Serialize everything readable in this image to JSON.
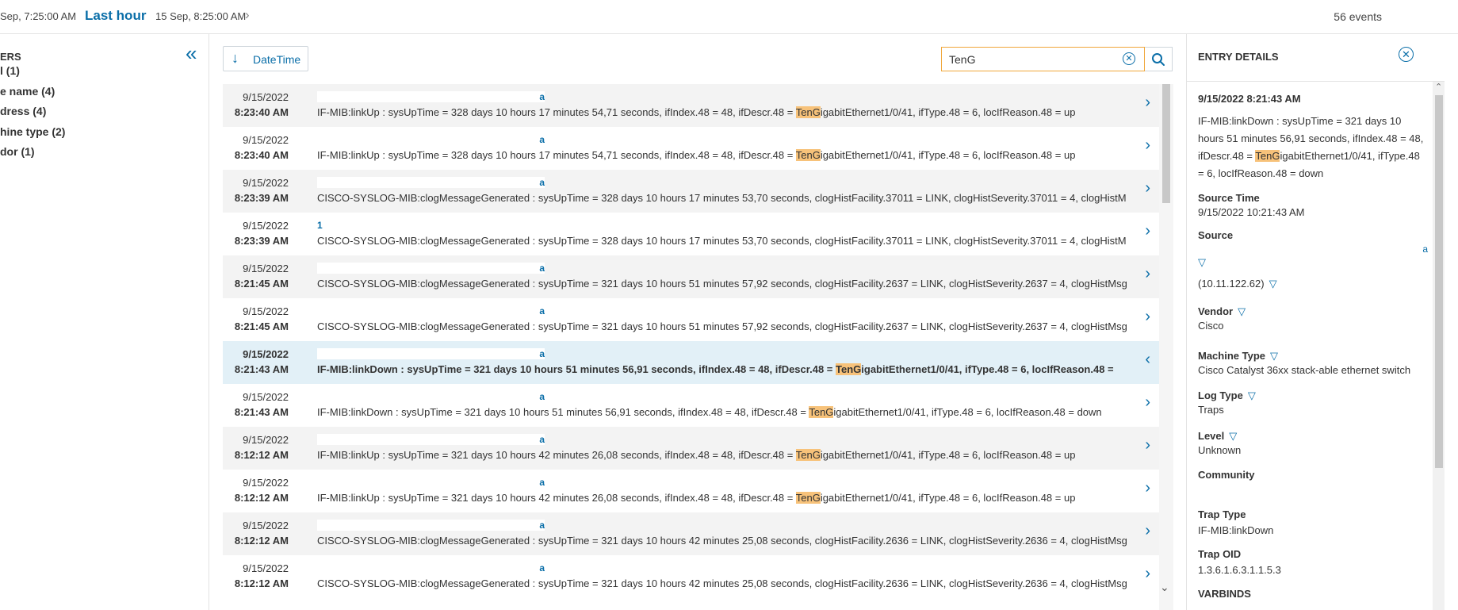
{
  "header": {
    "start": "Sep, 7:25:00 AM",
    "range_label": "Last hour",
    "end": "15 Sep, 8:25:00 AM",
    "event_count": "56 events"
  },
  "filters": {
    "title": "ERS",
    "items": [
      {
        "label": "l (1)"
      },
      {
        "label": "e name (4)"
      },
      {
        "label": "dress (4)"
      },
      {
        "label": "hine type (2)"
      },
      {
        "label": "dor (1)"
      }
    ]
  },
  "toolbar": {
    "sort_label": "DateTime",
    "search_value": "TenG",
    "search_placeholder": ""
  },
  "events": [
    {
      "date": "9/15/2022",
      "time": "8:23:40 AM",
      "source": "a",
      "pre": "IF-MIB:linkUp : sysUpTime = 328 days 10 hours 17 minutes 54,71 seconds, ifIndex.48 = 48, ifDescr.48 = ",
      "hl": "TenG",
      "post": "igabitEthernet1/0/41, ifType.48 = 6, locIfReason.48 = up"
    },
    {
      "date": "9/15/2022",
      "time": "8:23:40 AM",
      "source": "a",
      "pre": "IF-MIB:linkUp : sysUpTime = 328 days 10 hours 17 minutes 54,71 seconds, ifIndex.48 = 48, ifDescr.48 = ",
      "hl": "TenG",
      "post": "igabitEthernet1/0/41, ifType.48 = 6, locIfReason.48 = up"
    },
    {
      "date": "9/15/2022",
      "time": "8:23:39 AM",
      "source": "a",
      "pre": "CISCO-SYSLOG-MIB:clogMessageGenerated : sysUpTime = 328 days 10 hours 17 minutes 53,70 seconds, clogHistFacility.37011 = LINK, clogHistSeverity.37011 = 4, clogHistM",
      "hl": "",
      "post": ""
    },
    {
      "date": "9/15/2022",
      "time": "8:23:39 AM",
      "source": "1",
      "pre": "CISCO-SYSLOG-MIB:clogMessageGenerated : sysUpTime = 328 days 10 hours 17 minutes 53,70 seconds, clogHistFacility.37011 = LINK, clogHistSeverity.37011 = 4, clogHistM",
      "hl": "",
      "post": ""
    },
    {
      "date": "9/15/2022",
      "time": "8:21:45 AM",
      "source": "a",
      "pre": "CISCO-SYSLOG-MIB:clogMessageGenerated : sysUpTime = 321 days 10 hours 51 minutes 57,92 seconds, clogHistFacility.2637 = LINK, clogHistSeverity.2637 = 4, clogHistMsg",
      "hl": "",
      "post": ""
    },
    {
      "date": "9/15/2022",
      "time": "8:21:45 AM",
      "source": "a",
      "pre": "CISCO-SYSLOG-MIB:clogMessageGenerated : sysUpTime = 321 days 10 hours 51 minutes 57,92 seconds, clogHistFacility.2637 = LINK, clogHistSeverity.2637 = 4, clogHistMsg",
      "hl": "",
      "post": ""
    },
    {
      "date": "9/15/2022",
      "time": "8:21:43 AM",
      "source": "a",
      "pre": "IF-MIB:linkDown : sysUpTime = 321 days 10 hours 51 minutes 56,91 seconds, ifIndex.48 = 48, ifDescr.48 = ",
      "hl": "TenG",
      "post": "igabitEthernet1/0/41, ifType.48 = 6, locIfReason.48 = ",
      "selected": true
    },
    {
      "date": "9/15/2022",
      "time": "8:21:43 AM",
      "source": "a",
      "pre": "IF-MIB:linkDown : sysUpTime = 321 days 10 hours 51 minutes 56,91 seconds, ifIndex.48 = 48, ifDescr.48 = ",
      "hl": "TenG",
      "post": "igabitEthernet1/0/41, ifType.48 = 6, locIfReason.48 = down"
    },
    {
      "date": "9/15/2022",
      "time": "8:12:12 AM",
      "source": "a",
      "pre": "IF-MIB:linkUp : sysUpTime = 321 days 10 hours 42 minutes 26,08 seconds, ifIndex.48 = 48, ifDescr.48 = ",
      "hl": "TenG",
      "post": "igabitEthernet1/0/41, ifType.48 = 6, locIfReason.48 = up"
    },
    {
      "date": "9/15/2022",
      "time": "8:12:12 AM",
      "source": "a",
      "pre": "IF-MIB:linkUp : sysUpTime = 321 days 10 hours 42 minutes 26,08 seconds, ifIndex.48 = 48, ifDescr.48 = ",
      "hl": "TenG",
      "post": "igabitEthernet1/0/41, ifType.48 = 6, locIfReason.48 = up"
    },
    {
      "date": "9/15/2022",
      "time": "8:12:12 AM",
      "source": "a",
      "pre": "CISCO-SYSLOG-MIB:clogMessageGenerated : sysUpTime = 321 days 10 hours 42 minutes 25,08 seconds, clogHistFacility.2636 = LINK, clogHistSeverity.2636 = 4, clogHistMsg",
      "hl": "",
      "post": ""
    },
    {
      "date": "9/15/2022",
      "time": "8:12:12 AM",
      "source": "a",
      "pre": "CISCO-SYSLOG-MIB:clogMessageGenerated : sysUpTime = 321 days 10 hours 42 minutes 25,08 seconds, clogHistFacility.2636 = LINK, clogHistSeverity.2636 = 4, clogHistMsg",
      "hl": "",
      "post": ""
    }
  ],
  "details": {
    "title": "ENTRY DETAILS",
    "timestamp": "9/15/2022 8:21:43 AM",
    "message_pre": "IF-MIB:linkDown : sysUpTime = 321 days 10 hours 51 minutes 56,91 seconds, ifIndex.48 = 48, ifDescr.48 = ",
    "message_hl": "TenG",
    "message_post": "igabitEthernet1/0/41, ifType.48 = 6, locIfReason.48 = down",
    "source_time_label": "Source Time",
    "source_time": "9/15/2022 10:21:43 AM",
    "source_label": "Source",
    "source_name": "a",
    "source_ip": "(10.11.122.62)",
    "vendor_label": "Vendor",
    "vendor": "Cisco",
    "machine_type_label": "Machine Type",
    "machine_type": "Cisco Catalyst 36xx stack-able ethernet switch",
    "log_type_label": "Log Type",
    "log_type": "Traps",
    "level_label": "Level",
    "level": "Unknown",
    "community_label": "Community",
    "trap_type_label": "Trap Type",
    "trap_type": "IF-MIB:linkDown",
    "trap_oid_label": "Trap OID",
    "trap_oid": "1.3.6.1.6.3.1.1.5.3",
    "varbinds_label": "VARBINDS"
  },
  "icons": {
    "sort": "arrow-down-icon",
    "clear": "clear-circle-icon",
    "search": "search-icon",
    "close": "close-circle-icon",
    "filter": "funnel-icon",
    "collapse": "double-chevron-left-icon",
    "row_expand": "chevron-right-icon",
    "row_collapse": "chevron-left-icon"
  },
  "colors": {
    "accent": "#0a6ea8",
    "highlight": "#f7c27a",
    "selected_row": "#e2f0f7",
    "search_border": "#f0a63a"
  }
}
